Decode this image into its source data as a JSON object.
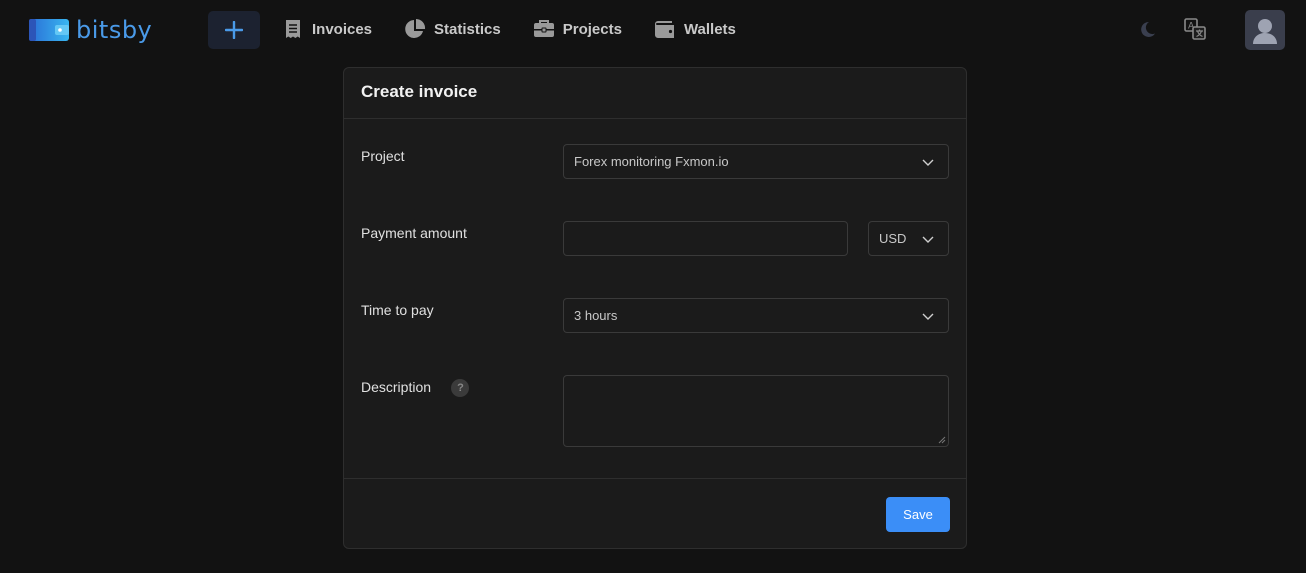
{
  "app": {
    "name": "bitsby"
  },
  "nav": {
    "items": [
      {
        "label": "Invoices",
        "icon": "receipt-icon"
      },
      {
        "label": "Statistics",
        "icon": "pie-chart-icon"
      },
      {
        "label": "Projects",
        "icon": "briefcase-icon"
      },
      {
        "label": "Wallets",
        "icon": "wallet-icon"
      }
    ]
  },
  "form": {
    "title": "Create invoice",
    "project": {
      "label": "Project",
      "value": "Forex monitoring Fxmon.io"
    },
    "amount": {
      "label": "Payment amount",
      "value": "",
      "currency": "USD"
    },
    "time": {
      "label": "Time to pay",
      "value": "3 hours"
    },
    "description": {
      "label": "Description",
      "help": "?",
      "value": ""
    },
    "save_label": "Save"
  },
  "colors": {
    "accent": "#3b8ef7",
    "brand": "#4a9ae8",
    "background": "#121212",
    "card": "#1b1b1b"
  }
}
